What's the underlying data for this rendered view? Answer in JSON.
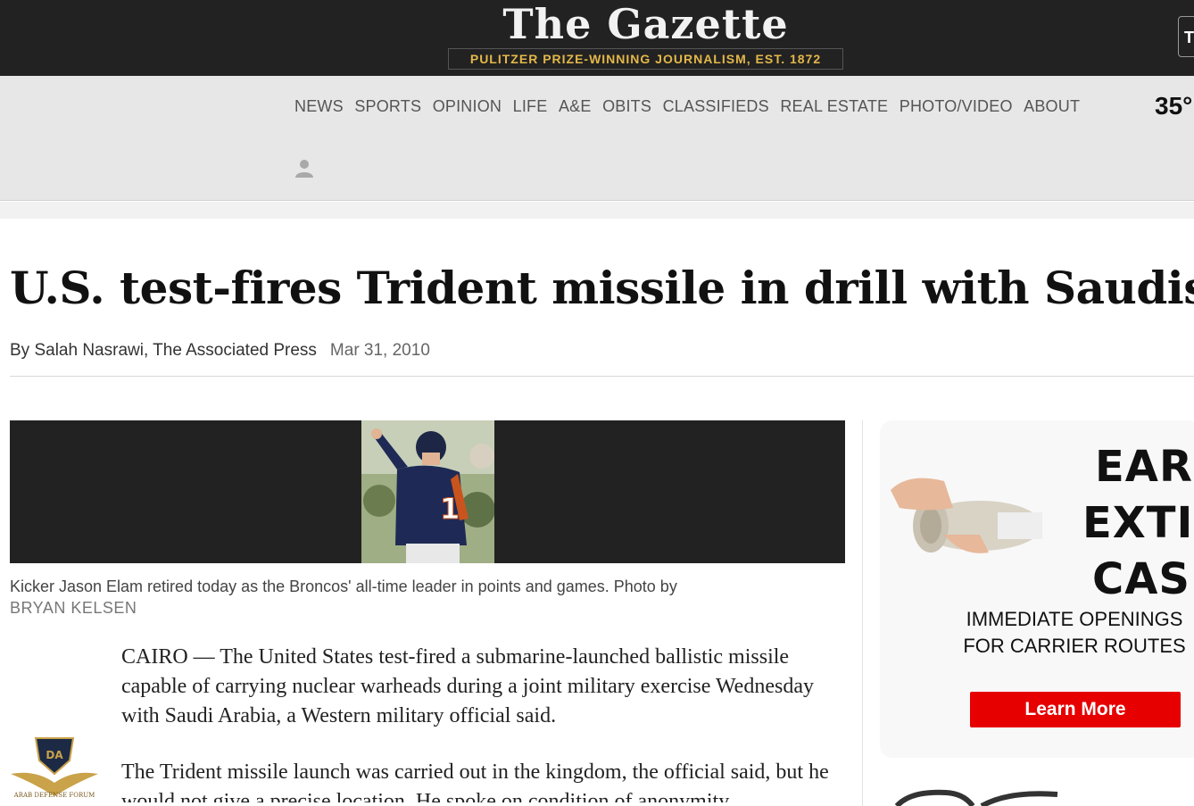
{
  "masthead": {
    "logo": "The Gazette",
    "tagline": "PULITZER PRIZE-WINNING JOURNALISM, EST. 1872",
    "corner_letter": "T"
  },
  "nav": {
    "items": [
      "NEWS",
      "SPORTS",
      "OPINION",
      "LIFE",
      "A&E",
      "OBITS",
      "CLASSIFIEDS",
      "REAL ESTATE",
      "PHOTO/VIDEO",
      "ABOUT"
    ],
    "temperature": "35°",
    "user_icon": "user-icon"
  },
  "article": {
    "headline": "U.S. test-fires Trident missile in drill with Saudis",
    "byline": "By Salah Nasrawi, The Associated Press",
    "date": "Mar 31, 2010",
    "caption": "Kicker Jason Elam retired today as the Broncos' all-time leader in points and games. Photo by",
    "credit": "BRYAN KELSEN",
    "paragraphs": [
      "CAIRO — The United States test-fired a submarine-launched ballistic missile capable of carrying nuclear warheads during a joint military exercise Wednesday with Saudi Arabia, a Western military official said.",
      "The Trident missile launch was carried out in the kingdom, the official said, but he would not give a precise location. He spoke on condition of anonymity"
    ]
  },
  "ad": {
    "line1": "EAR",
    "line2": "EXTI",
    "line3": "CAS",
    "subtext": "IMMEDIATE OPENINGS FOR CARRIER ROUTES",
    "button": "Learn More"
  },
  "watermark": {
    "badge": "DA",
    "text": "ARAB DEFENSE FORUM"
  },
  "colors": {
    "topbar": "#222222",
    "tagline": "#e3b74a",
    "nav_bg": "#e7e7e7",
    "ad_button": "#e60000"
  }
}
